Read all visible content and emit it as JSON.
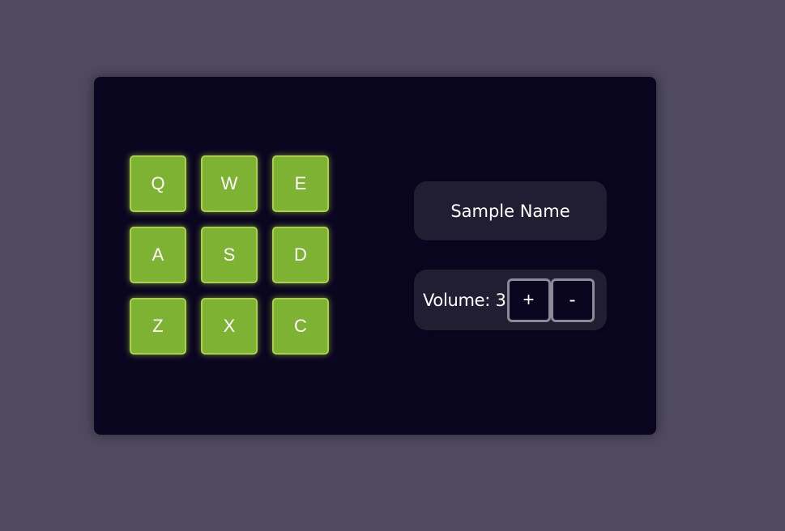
{
  "pads": [
    {
      "key": "Q"
    },
    {
      "key": "W"
    },
    {
      "key": "E"
    },
    {
      "key": "A"
    },
    {
      "key": "S"
    },
    {
      "key": "D"
    },
    {
      "key": "Z"
    },
    {
      "key": "X"
    },
    {
      "key": "C"
    }
  ],
  "display": {
    "sample_name": "Sample Name"
  },
  "volume": {
    "label": "Volume: 3",
    "increase_label": "+",
    "decrease_label": "-"
  },
  "colors": {
    "background": "#4f4a5f",
    "machine": "#0b0620",
    "pad": "#7db233",
    "pad_border": "#a9d04a",
    "panel": "#211e34",
    "button_border": "#8d8a96"
  }
}
